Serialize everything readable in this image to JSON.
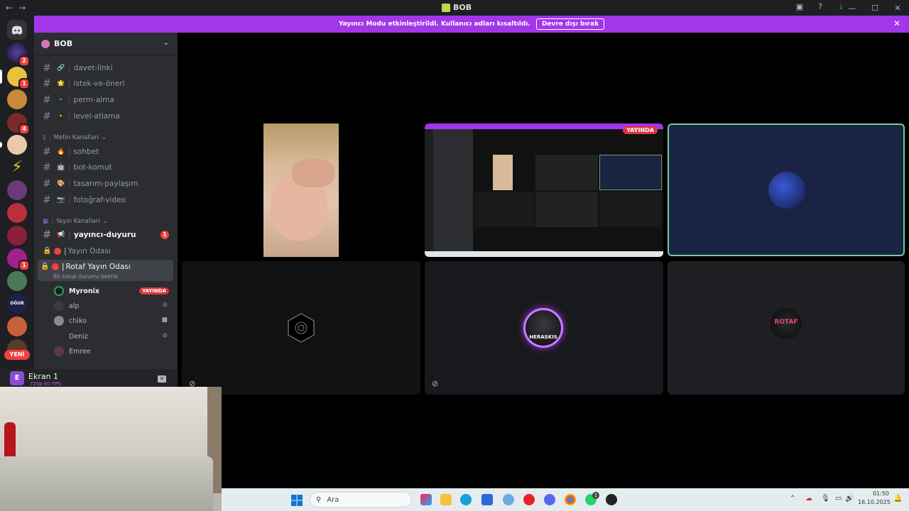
{
  "titlebar": {
    "title": "BOB",
    "back": "←",
    "forward": "→"
  },
  "banner": {
    "text": "Yayıncı Modu etkinleştirildi. Kullanıcı adları kısaltıldı.",
    "button": "Devre dışı bırak",
    "close": "✕"
  },
  "guilds": {
    "badges": [
      "2",
      "1",
      "4",
      "1"
    ],
    "new_label": "YENİ"
  },
  "server": {
    "name": "BOB",
    "chevron": "⌄"
  },
  "channels": [
    {
      "name": "davet-linki",
      "emoji": "🔗"
    },
    {
      "name": "istek-ve-öneri",
      "emoji": "🌟"
    },
    {
      "name": "perm-alma",
      "emoji": "🔹"
    },
    {
      "name": "level-atlama",
      "emoji": "🔸"
    }
  ],
  "categories": {
    "text": "Metin Kanalları",
    "stream": "Yayın Kanalları"
  },
  "text_channels": [
    {
      "name": "sohbet",
      "emoji": "🔥"
    },
    {
      "name": "bot-komut",
      "emoji": "🤖"
    },
    {
      "name": "tasarım-paylaşım",
      "emoji": "🎨"
    },
    {
      "name": "fotoğraf-video",
      "emoji": "📷"
    }
  ],
  "stream_channels": {
    "announce": {
      "name": "yayıncı-duyuru",
      "badge": "1"
    },
    "room1": {
      "name": "Yayın Odası"
    },
    "room2": {
      "name": "Rotaf Yayın Odası",
      "status": "Bir kanal durumu belirle"
    }
  },
  "voice_users": [
    {
      "name": "Myronix",
      "live": "YAYINDA"
    },
    {
      "name": "alp"
    },
    {
      "name": "chiko"
    },
    {
      "name": "Deniz"
    },
    {
      "name": "Emree"
    }
  ],
  "panel": {
    "initial": "E",
    "name": "Ekran 1",
    "quality": "720p 60 FPS"
  },
  "tiles": {
    "screen_live": "YAYINDA",
    "heraskis_label": "HERASKIS",
    "rotaf_label": "ROTAF"
  },
  "taskbar": {
    "search": "Ara",
    "time": "01:50",
    "date": "16.10.2025",
    "whatsapp_badge": "1"
  }
}
